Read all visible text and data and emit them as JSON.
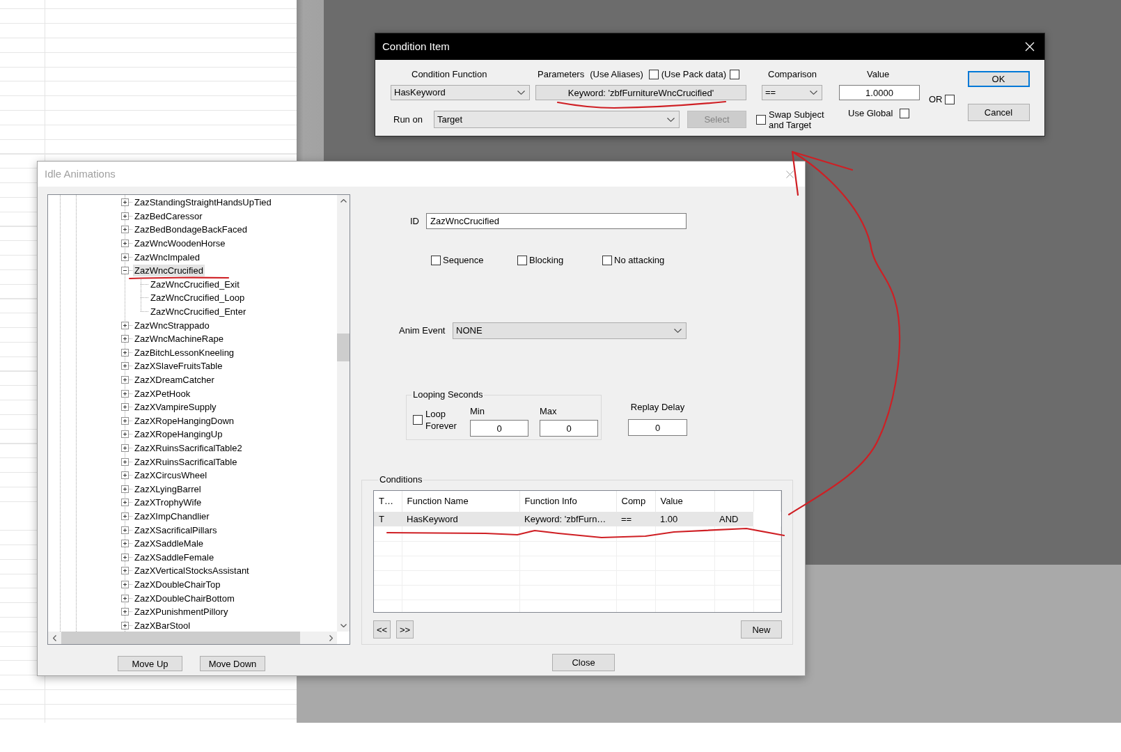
{
  "condition_item": {
    "title": "Condition Item",
    "active": true,
    "condition_function": {
      "label": "Condition Function",
      "value": "HasKeyword"
    },
    "parameters": {
      "label": "Parameters",
      "use_aliases": {
        "label": "(Use Aliases)",
        "checked": false
      },
      "use_pack_data": {
        "label": "(Use Pack data)",
        "checked": false
      },
      "value": "Keyword: 'zbfFurnitureWncCrucified'"
    },
    "comparison": {
      "label": "Comparison",
      "value": "=="
    },
    "value": {
      "label": "Value",
      "value": "1.0000"
    },
    "or": {
      "label": "OR",
      "checked": false
    },
    "run_on": {
      "label": "Run on",
      "value": "Target"
    },
    "select_button": {
      "label": "Select",
      "disabled": true
    },
    "swap_subject_and_target": {
      "label": "Swap Subject and Target",
      "checked": false
    },
    "use_global": {
      "label": "Use Global",
      "checked": false
    },
    "buttons": [
      {
        "label": "OK",
        "default": true
      },
      {
        "label": "Cancel",
        "default": false
      }
    ]
  },
  "idle_animations": {
    "title": "Idle Animations",
    "active": false,
    "tree": {
      "items": [
        {
          "label": "ZazStandingStraightHandsUpTied",
          "expanded": false,
          "selected": false
        },
        {
          "label": "ZazBedCaressor",
          "expanded": false,
          "selected": false
        },
        {
          "label": "ZazBedBondageBackFaced",
          "expanded": false,
          "selected": false
        },
        {
          "label": "ZazWncWoodenHorse",
          "expanded": false,
          "selected": false
        },
        {
          "label": "ZazWncImpaled",
          "expanded": false,
          "selected": false
        },
        {
          "label": "ZazWncCrucified",
          "expanded": true,
          "selected": true,
          "children": [
            {
              "label": "ZazWncCrucified_Exit",
              "selected": false
            },
            {
              "label": "ZazWncCrucified_Loop",
              "selected": false
            },
            {
              "label": "ZazWncCrucified_Enter",
              "selected": false
            }
          ]
        },
        {
          "label": "ZazWncStrappado",
          "expanded": false,
          "selected": false
        },
        {
          "label": "ZazWncMachineRape",
          "expanded": false,
          "selected": false
        },
        {
          "label": "ZazBitchLessonKneeling",
          "expanded": false,
          "selected": false
        },
        {
          "label": "ZazXSlaveFruitsTable",
          "expanded": false,
          "selected": false
        },
        {
          "label": "ZazXDreamCatcher",
          "expanded": false,
          "selected": false
        },
        {
          "label": "ZazXPetHook",
          "expanded": false,
          "selected": false
        },
        {
          "label": "ZazXVampireSupply",
          "expanded": false,
          "selected": false
        },
        {
          "label": "ZazXRopeHangingDown",
          "expanded": false,
          "selected": false
        },
        {
          "label": "ZazXRopeHangingUp",
          "expanded": false,
          "selected": false
        },
        {
          "label": "ZazXRuinsSacrificalTable2",
          "expanded": false,
          "selected": false
        },
        {
          "label": "ZazXRuinsSacrificalTable",
          "expanded": false,
          "selected": false
        },
        {
          "label": "ZazXCircusWheel",
          "expanded": false,
          "selected": false
        },
        {
          "label": "ZazXLyingBarrel",
          "expanded": false,
          "selected": false
        },
        {
          "label": "ZazXTrophyWife",
          "expanded": false,
          "selected": false
        },
        {
          "label": "ZazXImpChandlier",
          "expanded": false,
          "selected": false
        },
        {
          "label": "ZazXSacrificalPillars",
          "expanded": false,
          "selected": false
        },
        {
          "label": "ZazXSaddleMale",
          "expanded": false,
          "selected": false
        },
        {
          "label": "ZazXSaddleFemale",
          "expanded": false,
          "selected": false
        },
        {
          "label": "ZazXVerticalStocksAssistant",
          "expanded": false,
          "selected": false
        },
        {
          "label": "ZazXDoubleChairTop",
          "expanded": false,
          "selected": false
        },
        {
          "label": "ZazXDoubleChairBottom",
          "expanded": false,
          "selected": false
        },
        {
          "label": "ZazXPunishmentPillory",
          "expanded": false,
          "selected": false
        },
        {
          "label": "ZazXBarStool",
          "expanded": false,
          "selected": false
        }
      ]
    },
    "tree_buttons": [
      {
        "label": "Move Up"
      },
      {
        "label": "Move Down"
      }
    ],
    "id": {
      "label": "ID",
      "value": "ZazWncCrucified"
    },
    "flags": [
      {
        "label": "Sequence",
        "checked": false
      },
      {
        "label": "Blocking",
        "checked": false
      },
      {
        "label": "No attacking",
        "checked": false
      }
    ],
    "anim_event": {
      "label": "Anim Event",
      "value": "NONE"
    },
    "looping_seconds": {
      "title": "Looping Seconds",
      "loop_forever": {
        "label": "Loop Forever",
        "checked": false
      },
      "min": {
        "label": "Min",
        "value": "0"
      },
      "max": {
        "label": "Max",
        "value": "0"
      }
    },
    "replay_delay": {
      "label": "Replay Delay",
      "value": "0"
    },
    "conditions": {
      "title": "Conditions",
      "columns": [
        "T…",
        "Function Name",
        "Function Info",
        "Comp",
        "Value"
      ],
      "rows": [
        {
          "selected": true,
          "cells": [
            "T",
            "HasKeyword",
            "Keyword: 'zbfFurn…",
            "==",
            "1.00",
            "AND"
          ]
        }
      ],
      "buttons": [
        {
          "label": "<<"
        },
        {
          "label": ">>"
        },
        {
          "label": "New"
        }
      ]
    },
    "close_button": {
      "label": "Close"
    }
  }
}
